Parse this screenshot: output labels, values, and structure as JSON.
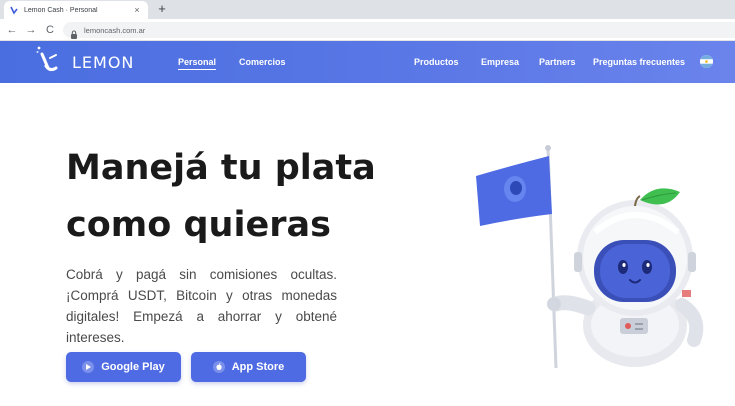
{
  "browser": {
    "tab_title": "Lemon Cash · Personal",
    "tab_close": "×",
    "new_tab": "+",
    "url": "lemoncash.com.ar",
    "nav_back": "←",
    "nav_forward": "→",
    "nav_reload": "C"
  },
  "header": {
    "logo_text": "LEMON",
    "nav_left": [
      {
        "label": "Personal",
        "active": true
      },
      {
        "label": "Comercios",
        "active": false
      }
    ],
    "nav_right": [
      {
        "label": "Productos"
      },
      {
        "label": "Empresa"
      },
      {
        "label": "Partners"
      },
      {
        "label": "Preguntas frecuentes"
      }
    ]
  },
  "hero": {
    "title_line1": "Manejá tu plata",
    "title_line2": "como quieras",
    "subtitle": "Cobrá y pagá sin comisiones ocultas. ¡Comprá USDT, Bitcoin y otras monedas digitales! Empezá a ahorrar y obtené intereses.",
    "buttons": [
      {
        "label": "Google Play",
        "icon": "google-play-icon"
      },
      {
        "label": "App Store",
        "icon": "apple-icon"
      }
    ]
  },
  "colors": {
    "brand_blue": "#4f6be3",
    "header_start": "#4a6ee0",
    "header_end": "#6b84ec",
    "text_dark": "#1a1a1a",
    "text_body": "#4a4a4a"
  }
}
